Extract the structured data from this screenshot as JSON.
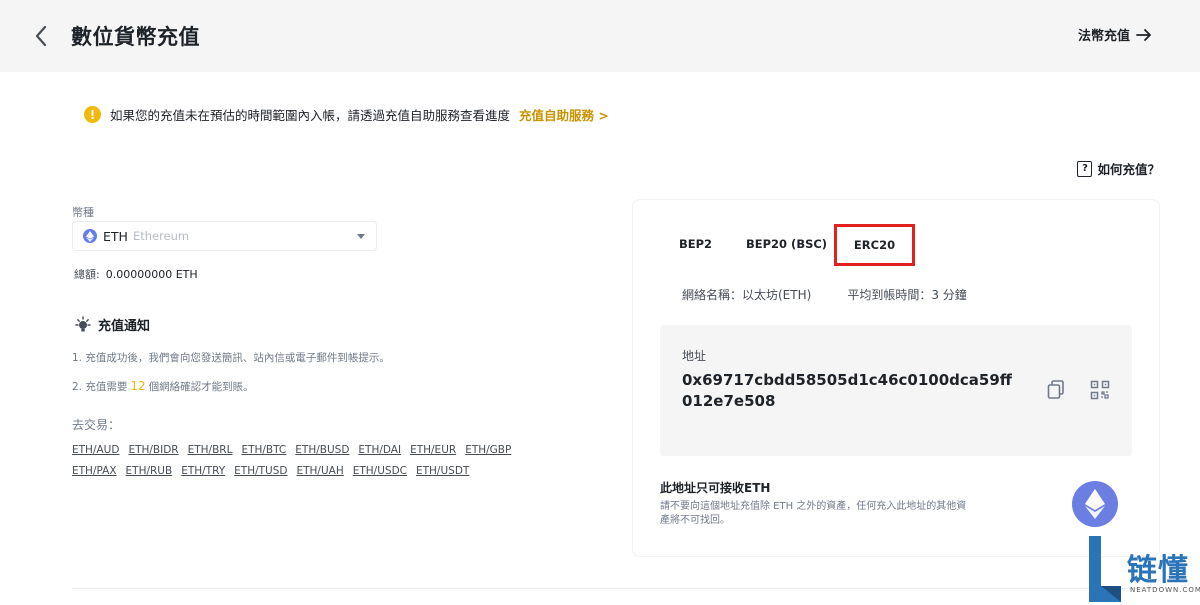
{
  "header": {
    "title": "數位貨幣充值",
    "fiat_link": "法幣充值"
  },
  "notice": {
    "text": "如果您的充值未在預估的時間範圍內入帳，請透過充值自助服務查看進度",
    "link": "充值自助服務 >"
  },
  "help": {
    "label": "如何充值？"
  },
  "coin": {
    "label": "幣種",
    "code": "ETH",
    "name": "Ethereum",
    "total_label": "總額:",
    "total_value": "0.00000000 ETH"
  },
  "notification": {
    "title": "充值通知",
    "line1": "1. 充值成功後，我們會向您發送簡訊、站內信或電子郵件到帳提示。",
    "line2_prefix": "2. 充值需要",
    "line2_count": "12",
    "line2_suffix": "個網絡確認才能到賬。"
  },
  "trade": {
    "label": "去交易：",
    "row1": [
      "ETH/AUD",
      "ETH/BIDR",
      "ETH/BRL",
      "ETH/BTC",
      "ETH/BUSD",
      "ETH/DAI",
      "ETH/EUR",
      "ETH/GBP"
    ],
    "row2": [
      "ETH/PAX",
      "ETH/RUB",
      "ETH/TRY",
      "ETH/TUSD",
      "ETH/UAH",
      "ETH/USDC",
      "ETH/USDT"
    ]
  },
  "networks": {
    "tabs": [
      "BEP2",
      "BEP20 (BSC)",
      "ERC20"
    ],
    "selected": "ERC20",
    "network_name": "網絡名稱：以太坊(ETH)",
    "avg_time": "平均到帳時間：3 分鐘"
  },
  "address": {
    "label": "地址",
    "value": "0x69717cbdd58505d1c46c0100dca59ff012e7e508"
  },
  "warning": {
    "title": "此地址只可接收ETH",
    "text": "請不要向這個地址充值除 ETH 之外的資產，任何充入此地址的其他資產將不可找回。"
  },
  "watermark": {
    "text": "链懂",
    "sub": "NEATDOWN.COM"
  },
  "colors": {
    "accent": "#f0b90b",
    "highlight_box": "#e0211d",
    "eth": "#627eea"
  }
}
